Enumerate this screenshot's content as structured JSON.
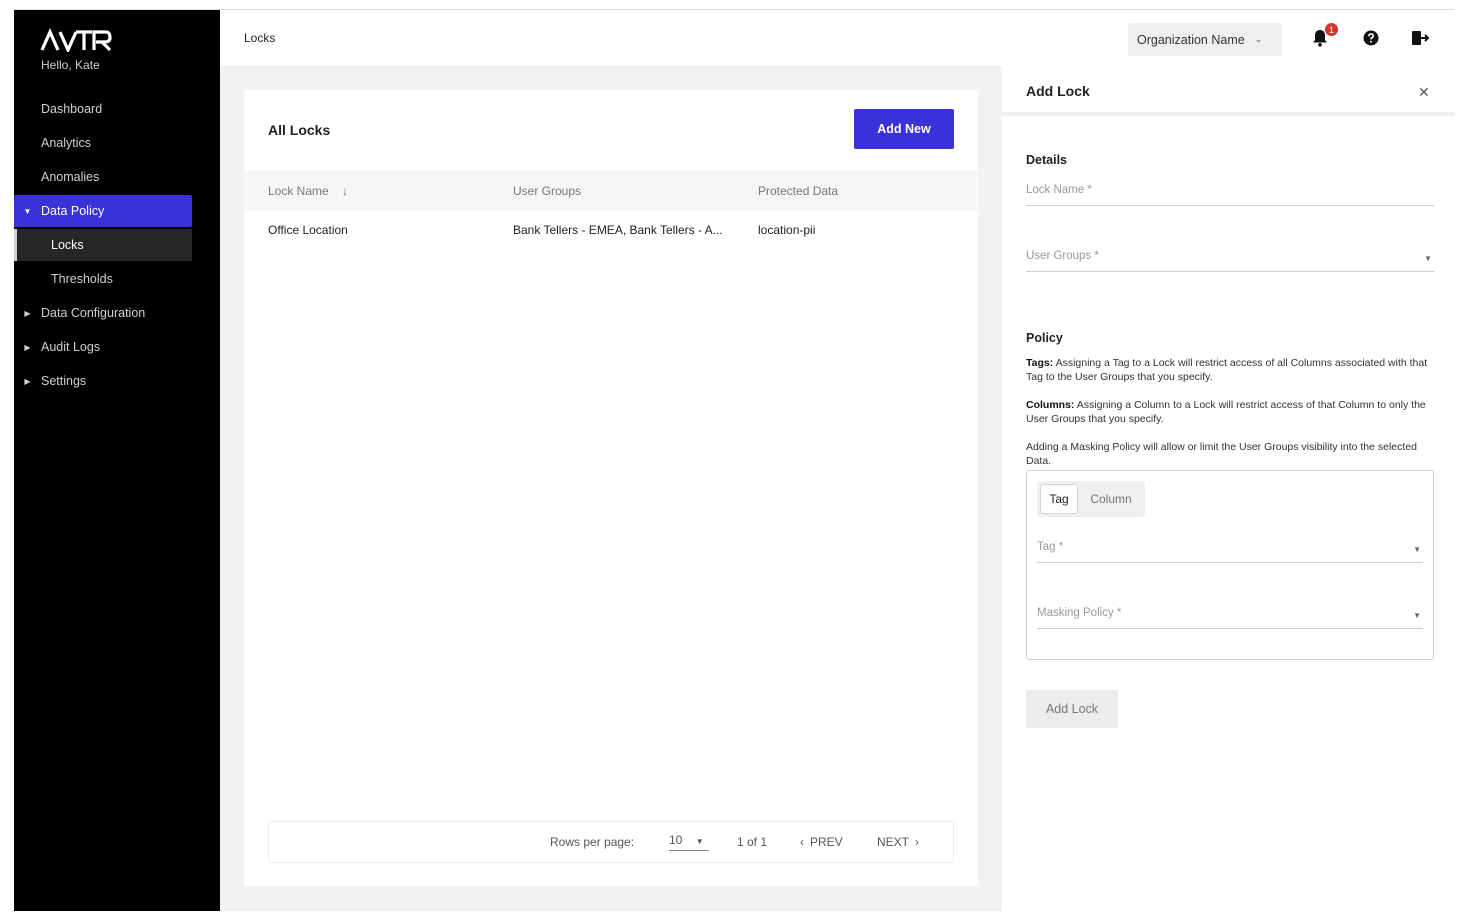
{
  "sidebar": {
    "logo_text": "ALTR",
    "greeting": "Hello, Kate",
    "items": [
      {
        "label": "Dashboard"
      },
      {
        "label": "Analytics"
      },
      {
        "label": "Anomalies"
      },
      {
        "label": "Data Policy"
      },
      {
        "label": "Locks"
      },
      {
        "label": "Thresholds"
      },
      {
        "label": "Data Configuration"
      },
      {
        "label": "Audit Logs"
      },
      {
        "label": "Settings"
      }
    ]
  },
  "topbar": {
    "breadcrumb": "Locks",
    "org_select": "Organization Name",
    "notification_count": "1",
    "icons": [
      "bell-icon",
      "help-icon",
      "logout-icon"
    ]
  },
  "locks": {
    "title": "All Locks",
    "add_new_label": "Add New",
    "columns": [
      "Lock Name",
      "User Groups",
      "Protected Data"
    ],
    "rows": [
      {
        "lock_name": "Office Location",
        "user_groups": "Bank Tellers - EMEA, Bank Tellers - A...",
        "protected_data": "location-pii"
      }
    ],
    "pagination": {
      "rows_per_page_label": "Rows per page:",
      "rows_per_page_value": "10",
      "page_info": "1 of 1",
      "prev_label": "PREV",
      "next_label": "NEXT"
    }
  },
  "panel": {
    "title": "Add Lock",
    "details_heading": "Details",
    "lock_name_label": "Lock Name *",
    "user_groups_label": "User Groups *",
    "policy_heading": "Policy",
    "tags_term": "Tags:",
    "tags_text": "Assigning a Tag to a Lock will restrict access of all Columns associated with that Tag to the User Groups that you specify.",
    "columns_term": "Columns:",
    "columns_text": "Assigning a Column to a Lock will restrict access of that Column to only the User Groups that you specify.",
    "masking_text": "Adding a Masking Policy will allow or limit the User Groups visibility into the selected Data.",
    "toggle_tag": "Tag",
    "toggle_column": "Column",
    "tag_label": "Tag *",
    "masking_label": "Masking Policy *",
    "add_lock_button": "Add Lock"
  },
  "colors": {
    "accent": "#3a31d8",
    "sidebar_bg": "#000000",
    "badge": "#d9352b"
  }
}
